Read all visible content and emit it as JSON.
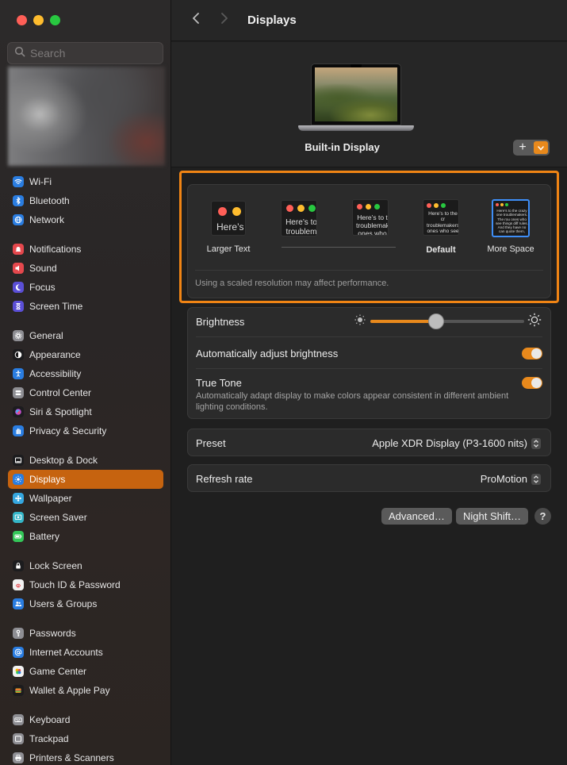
{
  "window": {
    "title": "Displays"
  },
  "search": {
    "placeholder": "Search"
  },
  "sidebar": {
    "groups": [
      [
        {
          "label": "Wi-Fi",
          "icon": "wifi-icon",
          "color": "#2a7de1"
        },
        {
          "label": "Bluetooth",
          "icon": "bluetooth-icon",
          "color": "#2a7de1"
        },
        {
          "label": "Network",
          "icon": "globe-icon",
          "color": "#2a7de1"
        }
      ],
      [
        {
          "label": "Notifications",
          "icon": "bell-icon",
          "color": "#e5484d"
        },
        {
          "label": "Sound",
          "icon": "speaker-icon",
          "color": "#e5484d"
        },
        {
          "label": "Focus",
          "icon": "moon-icon",
          "color": "#5b4fd6"
        },
        {
          "label": "Screen Time",
          "icon": "hourglass-icon",
          "color": "#5b4fd6"
        }
      ],
      [
        {
          "label": "General",
          "icon": "gear-icon",
          "color": "#8e8e93"
        },
        {
          "label": "Appearance",
          "icon": "appearance-icon",
          "color": "#1c1c1e"
        },
        {
          "label": "Accessibility",
          "icon": "accessibility-icon",
          "color": "#2a7de1"
        },
        {
          "label": "Control Center",
          "icon": "control-center-icon",
          "color": "#8e8e93"
        },
        {
          "label": "Siri & Spotlight",
          "icon": "siri-icon",
          "color": "#1c1c1e"
        },
        {
          "label": "Privacy & Security",
          "icon": "hand-icon",
          "color": "#2a7de1"
        }
      ],
      [
        {
          "label": "Desktop & Dock",
          "icon": "dock-icon",
          "color": "#1c1c1e"
        },
        {
          "label": "Displays",
          "icon": "sun-icon",
          "color": "#2a7de1",
          "active": true
        },
        {
          "label": "Wallpaper",
          "icon": "wallpaper-icon",
          "color": "#35a7e0"
        },
        {
          "label": "Screen Saver",
          "icon": "screen-saver-icon",
          "color": "#35b6c8"
        },
        {
          "label": "Battery",
          "icon": "battery-icon",
          "color": "#34c759"
        }
      ],
      [
        {
          "label": "Lock Screen",
          "icon": "lock-icon",
          "color": "#1c1c1e"
        },
        {
          "label": "Touch ID & Password",
          "icon": "fingerprint-icon",
          "color": "#f2f2f2"
        },
        {
          "label": "Users & Groups",
          "icon": "users-icon",
          "color": "#2a7de1"
        }
      ],
      [
        {
          "label": "Passwords",
          "icon": "key-icon",
          "color": "#8e8e93"
        },
        {
          "label": "Internet Accounts",
          "icon": "at-icon",
          "color": "#2a7de1"
        },
        {
          "label": "Game Center",
          "icon": "game-center-icon",
          "color": "#f2f2f2"
        },
        {
          "label": "Wallet & Apple Pay",
          "icon": "wallet-icon",
          "color": "#1c1c1e"
        }
      ],
      [
        {
          "label": "Keyboard",
          "icon": "keyboard-icon",
          "color": "#8e8e93"
        },
        {
          "label": "Trackpad",
          "icon": "trackpad-icon",
          "color": "#8e8e93"
        },
        {
          "label": "Printers & Scanners",
          "icon": "printer-icon",
          "color": "#8e8e93"
        }
      ]
    ]
  },
  "display": {
    "name": "Built-in Display",
    "add_label": "+"
  },
  "resolution": {
    "options": [
      {
        "label": "Larger Text",
        "sample": "Here’s"
      },
      {
        "label": "",
        "sample": "Here’s to troublem"
      },
      {
        "label": "",
        "sample": "Here’s to t troublemak ones who"
      },
      {
        "label": "Default",
        "sample": "Here’s to the cr troublemakers. ones who see t rules. And they"
      },
      {
        "label": "More Space",
        "sample": "Here’s to the crazy one troublemakers. The rou ones who see things diff rules. And they have no can quote them, disagr them. About the only th Because they change th"
      }
    ],
    "note": "Using a scaled resolution may affect performance."
  },
  "brightness": {
    "label": "Brightness",
    "level_percent": 43,
    "auto_label": "Automatically adjust brightness",
    "auto_on": true,
    "true_tone_label": "True Tone",
    "true_tone_desc": "Automatically adapt display to make colors appear consistent in different ambient lighting conditions.",
    "true_tone_on": true
  },
  "preset": {
    "label": "Preset",
    "value": "Apple XDR Display (P3-1600 nits)"
  },
  "refresh": {
    "label": "Refresh rate",
    "value": "ProMotion"
  },
  "buttons": {
    "advanced": "Advanced…",
    "night_shift": "Night Shift…",
    "help": "?"
  },
  "colors": {
    "accent": "#e8891c",
    "selection": "#c6630f",
    "highlight_frame": "#f08414"
  }
}
